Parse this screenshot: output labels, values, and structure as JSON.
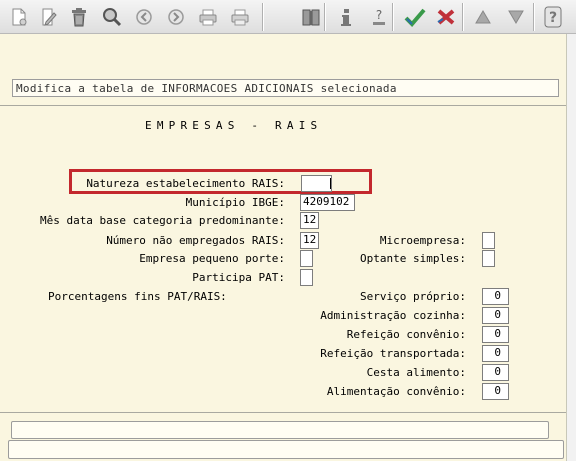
{
  "toolbar": {
    "buttons": [
      {
        "icon": "new-document-icon"
      },
      {
        "icon": "edit-pencil-icon"
      },
      {
        "icon": "trash-icon"
      },
      {
        "icon": "search-magnifier-icon"
      },
      {
        "icon": "previous-circle-icon"
      },
      {
        "icon": "next-circle-icon"
      },
      {
        "icon": "print-icon"
      },
      {
        "icon": "print-preview-icon"
      },
      {
        "icon": "book-icon"
      },
      {
        "icon": "info-icon"
      },
      {
        "icon": "help-topic-icon"
      },
      {
        "icon": "confirm-check-icon"
      },
      {
        "icon": "cancel-x-icon"
      },
      {
        "icon": "arrow-up-icon"
      },
      {
        "icon": "arrow-down-icon"
      },
      {
        "icon": "question-help-icon"
      }
    ]
  },
  "message": "Modifica a tabela de INFORMACOES ADICIONAIS selecionada",
  "form": {
    "title": "EMPRESAS - RAIS",
    "natureza_label": "Natureza estabelecimento RAIS:",
    "natureza_value": "",
    "municipio_label": "Município IBGE:",
    "municipio_value": "4209102",
    "mes_label": "Mês data base categoria predominante:",
    "mes_value": "12",
    "empregados_label": "Número não empregados RAIS:",
    "empregados_value": "12",
    "microempresa_label": "Microempresa:",
    "microempresa_value": "",
    "pequeno_porte_label": "Empresa pequeno porte:",
    "pequeno_porte_value": "",
    "optante_label": "Optante simples:",
    "optante_value": "",
    "pat_label": "Participa PAT:",
    "pat_value": "",
    "porcentagens_label": "Porcentagens fins PAT/RAIS:",
    "percentages": [
      {
        "label": "Serviço próprio:",
        "value": "0"
      },
      {
        "label": "Administração cozinha:",
        "value": "0"
      },
      {
        "label": "Refeição convênio:",
        "value": "0"
      },
      {
        "label": "Refeição transportada:",
        "value": "0"
      },
      {
        "label": "Cesta alimento:",
        "value": "0"
      },
      {
        "label": "Alimentação convênio:",
        "value": "0"
      }
    ]
  },
  "colors": {
    "background": "#faf6e0",
    "highlight": "#c3282d",
    "confirm": "#3a9a4a",
    "cancel": "#c0303a"
  }
}
